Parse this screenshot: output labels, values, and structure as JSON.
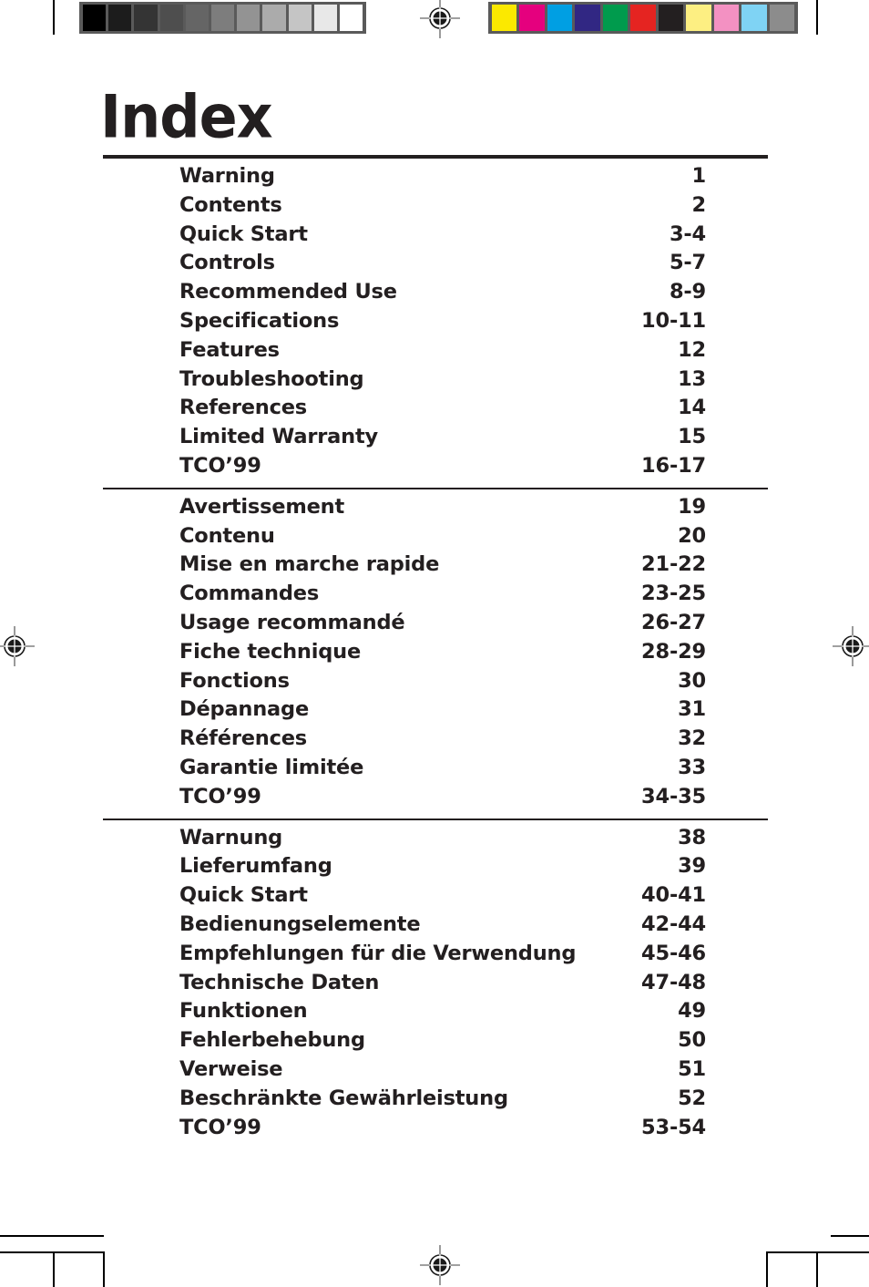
{
  "page": {
    "title": "Index",
    "background_color": "#ffffff",
    "text_color": "#231f20"
  },
  "calibration": {
    "grayscale_strip": {
      "name": "grayscale-calibration-strip",
      "frame_color": "#5a5a5a",
      "patches": [
        "#000000",
        "#1c1c1c",
        "#343434",
        "#4e4e4e",
        "#656565",
        "#7d7d7d",
        "#939393",
        "#ababab",
        "#c5c5c5",
        "#e8e8e8",
        "#ffffff"
      ]
    },
    "color_strip": {
      "name": "color-calibration-strip",
      "frame_color": "#5a5a5a",
      "patches": [
        "#fbe900",
        "#e5007e",
        "#009fe3",
        "#312783",
        "#009b4d",
        "#e52421",
        "#231f20",
        "#fdef82",
        "#f391c2",
        "#7fd3f4",
        "#8c8c8c"
      ]
    }
  },
  "registration_marks": {
    "icon": "registration-target-icon",
    "positions": [
      "top-center",
      "left-middle",
      "right-middle",
      "bottom-center"
    ]
  },
  "index": {
    "sections": [
      {
        "language": "english",
        "entries": [
          {
            "label": "Warning",
            "pages": "1"
          },
          {
            "label": "Contents",
            "pages": "2"
          },
          {
            "label": "Quick Start",
            "pages": "3-4"
          },
          {
            "label": "Controls",
            "pages": "5-7"
          },
          {
            "label": "Recommended Use",
            "pages": "8-9"
          },
          {
            "label": "Specifications",
            "pages": "10-11"
          },
          {
            "label": "Features",
            "pages": "12"
          },
          {
            "label": "Troubleshooting",
            "pages": "13"
          },
          {
            "label": "References",
            "pages": "14"
          },
          {
            "label": "Limited Warranty",
            "pages": "15"
          },
          {
            "label": "TCO’99",
            "pages": "16-17"
          }
        ]
      },
      {
        "language": "french",
        "entries": [
          {
            "label": "Avertissement",
            "pages": "19"
          },
          {
            "label": "Contenu",
            "pages": "20"
          },
          {
            "label": "Mise en marche rapide",
            "pages": "21-22"
          },
          {
            "label": "Commandes",
            "pages": "23-25"
          },
          {
            "label": "Usage recommandé",
            "pages": "26-27"
          },
          {
            "label": "Fiche technique",
            "pages": "28-29"
          },
          {
            "label": "Fonctions",
            "pages": "30"
          },
          {
            "label": "Dépannage",
            "pages": "31"
          },
          {
            "label": "Références",
            "pages": "32"
          },
          {
            "label": "Garantie limitée",
            "pages": "33"
          },
          {
            "label": "TCO’99",
            "pages": "34-35"
          }
        ]
      },
      {
        "language": "german",
        "entries": [
          {
            "label": "Warnung",
            "pages": "38"
          },
          {
            "label": "Lieferumfang",
            "pages": "39"
          },
          {
            "label": "Quick Start",
            "pages": "40-41"
          },
          {
            "label": "Bedienungselemente",
            "pages": "42-44"
          },
          {
            "label": "Empfehlungen für die Verwendung",
            "pages": "45-46"
          },
          {
            "label": "Technische Daten",
            "pages": "47-48"
          },
          {
            "label": "Funktionen",
            "pages": "49"
          },
          {
            "label": "Fehlerbehebung",
            "pages": "50"
          },
          {
            "label": "Verweise",
            "pages": "51"
          },
          {
            "label": "Beschränkte Gewährleistung",
            "pages": "52"
          },
          {
            "label": "TCO’99",
            "pages": "53-54"
          }
        ]
      }
    ]
  }
}
